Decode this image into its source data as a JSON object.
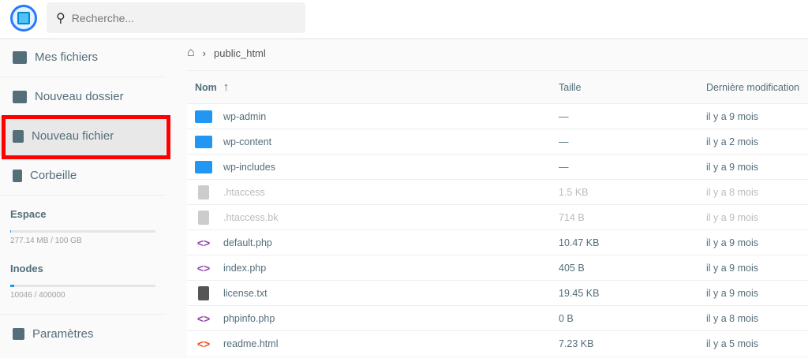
{
  "search": {
    "placeholder": "Recherche..."
  },
  "sidebar": {
    "items": [
      {
        "label": "Mes fichiers"
      },
      {
        "label": "Nouveau dossier"
      },
      {
        "label": "Nouveau fichier"
      },
      {
        "label": "Corbeille"
      }
    ],
    "space": {
      "title": "Espace",
      "text": "277.14 MB / 100 GB",
      "fraction": 0.0028
    },
    "inodes": {
      "title": "Inodes",
      "text": "10046 / 400000",
      "fraction": 0.025
    },
    "settings": "Paramètres"
  },
  "breadcrumb": {
    "current": "public_html"
  },
  "table": {
    "headers": {
      "name": "Nom",
      "size": "Taille",
      "modified": "Dernière modification"
    },
    "rows": [
      {
        "name": "wp-admin",
        "size": "—",
        "modified": "il y a 9 mois",
        "type": "folder"
      },
      {
        "name": "wp-content",
        "size": "—",
        "modified": "il y a 2 mois",
        "type": "folder"
      },
      {
        "name": "wp-includes",
        "size": "—",
        "modified": "il y a 9 mois",
        "type": "folder"
      },
      {
        "name": ".htaccess",
        "size": "1.5 KB",
        "modified": "il y a 8 mois",
        "type": "hidden"
      },
      {
        "name": ".htaccess.bk",
        "size": "714 B",
        "modified": "il y a 9 mois",
        "type": "hidden"
      },
      {
        "name": "default.php",
        "size": "10.47 KB",
        "modified": "il y a 9 mois",
        "type": "code"
      },
      {
        "name": "index.php",
        "size": "405 B",
        "modified": "il y a 9 mois",
        "type": "code"
      },
      {
        "name": "license.txt",
        "size": "19.45 KB",
        "modified": "il y a 9 mois",
        "type": "text"
      },
      {
        "name": "phpinfo.php",
        "size": "0 B",
        "modified": "il y a 8 mois",
        "type": "code"
      },
      {
        "name": "readme.html",
        "size": "7.23 KB",
        "modified": "il y a 5 mois",
        "type": "html"
      }
    ]
  }
}
